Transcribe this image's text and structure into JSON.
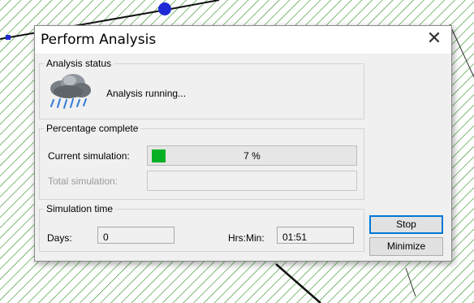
{
  "dialog": {
    "title": "Perform Analysis",
    "close_glyph": "✕"
  },
  "analysis_status": {
    "legend": "Analysis status",
    "icon": "rain-cloud-icon",
    "text": "Analysis running..."
  },
  "percentage": {
    "legend": "Percentage complete",
    "current_label": "Current simulation:",
    "current_value": 7,
    "current_text": "7 %",
    "total_label": "Total simulation:",
    "total_value": 0,
    "fill_color": "#06b025"
  },
  "sim_time": {
    "legend": "Simulation time",
    "days_label": "Days:",
    "days_value": "0",
    "hrsmin_label": "Hrs:Min:",
    "hrsmin_value": "01:51"
  },
  "buttons": {
    "stop": "Stop",
    "minimize": "Minimize"
  },
  "colors": {
    "hatch": "#2e8b22",
    "accent": "#0078d7"
  }
}
